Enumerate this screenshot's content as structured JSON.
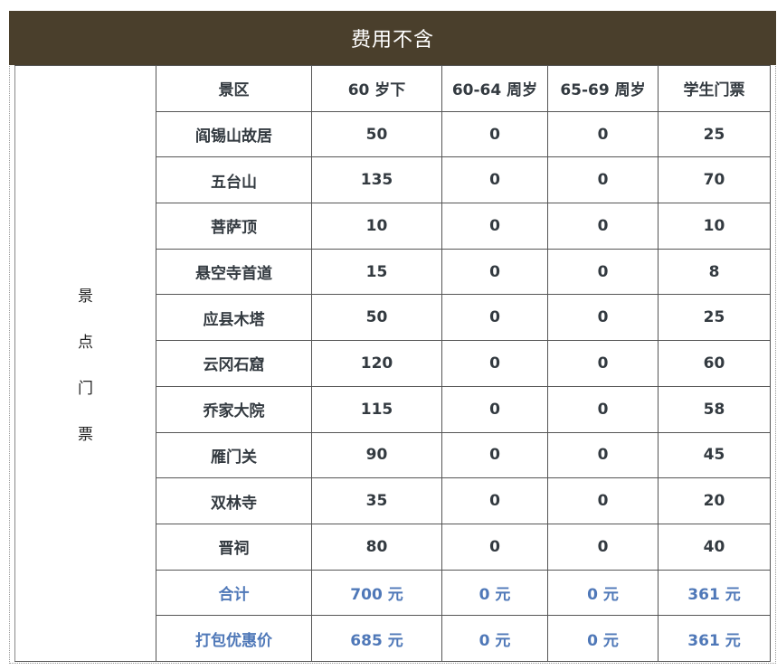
{
  "banner": {
    "title": "费用不含"
  },
  "side_label": [
    "景",
    "点",
    "门",
    "票"
  ],
  "header": [
    "景区",
    "60 岁下",
    "60-64 周岁",
    "65-69 周岁",
    "学生门票"
  ],
  "rows": [
    [
      "阎锡山故居",
      "50",
      "0",
      "0",
      "25"
    ],
    [
      "五台山",
      "135",
      "0",
      "0",
      "70"
    ],
    [
      "菩萨顶",
      "10",
      "0",
      "0",
      "10"
    ],
    [
      "悬空寺首道",
      "15",
      "0",
      "0",
      "8"
    ],
    [
      "应县木塔",
      "50",
      "0",
      "0",
      "25"
    ],
    [
      "云冈石窟",
      "120",
      "0",
      "0",
      "60"
    ],
    [
      "乔家大院",
      "115",
      "0",
      "0",
      "58"
    ],
    [
      "雁门关",
      "90",
      "0",
      "0",
      "45"
    ],
    [
      "双林寺",
      "35",
      "0",
      "0",
      "20"
    ],
    [
      "晋祠",
      "80",
      "0",
      "0",
      "40"
    ]
  ],
  "totals": [
    [
      "合计",
      "700 元",
      "0 元",
      "0 元",
      "361 元"
    ],
    [
      "打包优惠价",
      "685 元",
      "0 元",
      "0 元",
      "361 元"
    ]
  ],
  "colors": {
    "banner_bg": "#4a3f2c",
    "summary_text": "#4f78b8"
  }
}
